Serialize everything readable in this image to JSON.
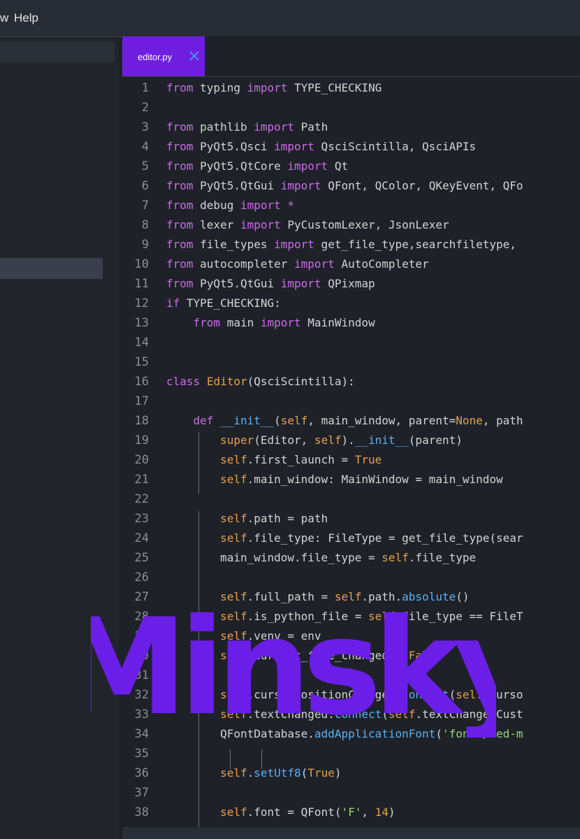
{
  "menubar": {
    "item_view_partial": "w",
    "item_help": "Help"
  },
  "tab": {
    "label": "editor.py",
    "close_icon": "close-icon"
  },
  "watermark": {
    "text": "Minsky"
  },
  "lines": [
    {
      "n": "1",
      "segs": [
        [
          "kw",
          "from"
        ],
        [
          "",
          " typing "
        ],
        [
          "kw",
          "import"
        ],
        [
          "",
          " TYPE_CHECKING"
        ]
      ]
    },
    {
      "n": "2",
      "segs": []
    },
    {
      "n": "3",
      "segs": [
        [
          "kw",
          "from"
        ],
        [
          "",
          " pathlib "
        ],
        [
          "kw",
          "import"
        ],
        [
          "",
          " Path"
        ]
      ]
    },
    {
      "n": "4",
      "segs": [
        [
          "kw",
          "from"
        ],
        [
          "",
          " PyQt5.Qsci "
        ],
        [
          "kw",
          "import"
        ],
        [
          "",
          " QsciScintilla, QsciAPIs"
        ]
      ]
    },
    {
      "n": "5",
      "segs": [
        [
          "kw",
          "from"
        ],
        [
          "",
          " PyQt5.QtCore "
        ],
        [
          "kw",
          "import"
        ],
        [
          "",
          " Qt"
        ]
      ]
    },
    {
      "n": "6",
      "segs": [
        [
          "kw",
          "from"
        ],
        [
          "",
          " PyQt5.QtGui "
        ],
        [
          "kw",
          "import"
        ],
        [
          "",
          " QFont, QColor, QKeyEvent, QFo"
        ]
      ]
    },
    {
      "n": "7",
      "segs": [
        [
          "kw",
          "from"
        ],
        [
          "",
          " debug "
        ],
        [
          "kw",
          "import"
        ],
        [
          "",
          " "
        ],
        [
          "op",
          "*"
        ]
      ]
    },
    {
      "n": "8",
      "segs": [
        [
          "kw",
          "from"
        ],
        [
          "",
          " lexer "
        ],
        [
          "kw",
          "import"
        ],
        [
          "",
          " PyCustomLexer, JsonLexer"
        ]
      ]
    },
    {
      "n": "9",
      "segs": [
        [
          "kw",
          "from"
        ],
        [
          "",
          " file_types "
        ],
        [
          "kw",
          "import"
        ],
        [
          "",
          " get_file_type,searchfiletype,"
        ]
      ]
    },
    {
      "n": "10",
      "segs": [
        [
          "kw",
          "from"
        ],
        [
          "",
          " autocompleter "
        ],
        [
          "kw",
          "import"
        ],
        [
          "",
          " AutoCompleter"
        ]
      ]
    },
    {
      "n": "11",
      "segs": [
        [
          "kw",
          "from"
        ],
        [
          "",
          " PyQt5.QtGui "
        ],
        [
          "kw",
          "import"
        ],
        [
          "",
          " QPixmap"
        ]
      ]
    },
    {
      "n": "12",
      "segs": [
        [
          "kw",
          "if"
        ],
        [
          "",
          " TYPE_CHECKING:"
        ]
      ]
    },
    {
      "n": "13",
      "segs": [
        [
          "",
          "    "
        ],
        [
          "kw",
          "from"
        ],
        [
          "",
          " main "
        ],
        [
          "kw",
          "import"
        ],
        [
          "",
          " MainWindow"
        ]
      ]
    },
    {
      "n": "14",
      "segs": []
    },
    {
      "n": "15",
      "segs": []
    },
    {
      "n": "16",
      "segs": [
        [
          "kw",
          "class"
        ],
        [
          "",
          " "
        ],
        [
          "cls",
          "Editor"
        ],
        [
          "",
          "(QsciScintilla):"
        ]
      ]
    },
    {
      "n": "17",
      "segs": []
    },
    {
      "n": "18",
      "segs": [
        [
          "",
          "    "
        ],
        [
          "kw",
          "def"
        ],
        [
          "",
          " "
        ],
        [
          "fn",
          "__init__"
        ],
        [
          "",
          "("
        ],
        [
          "self",
          "self"
        ],
        [
          "",
          ", main_window, parent="
        ],
        [
          "const",
          "None"
        ],
        [
          "",
          ", path"
        ]
      ]
    },
    {
      "n": "19",
      "segs": [
        [
          "",
          "        "
        ],
        [
          "self",
          "super"
        ],
        [
          "",
          "(Editor, "
        ],
        [
          "self",
          "self"
        ],
        [
          "",
          ")."
        ],
        [
          "fn",
          "__init__"
        ],
        [
          "",
          "(parent)"
        ]
      ]
    },
    {
      "n": "20",
      "segs": [
        [
          "",
          "        "
        ],
        [
          "self",
          "self"
        ],
        [
          "",
          ".first_launch = "
        ],
        [
          "const",
          "True"
        ]
      ]
    },
    {
      "n": "21",
      "segs": [
        [
          "",
          "        "
        ],
        [
          "self",
          "self"
        ],
        [
          "",
          ".main_window: MainWindow = main_window"
        ]
      ]
    },
    {
      "n": "22",
      "segs": []
    },
    {
      "n": "23",
      "segs": [
        [
          "",
          "        "
        ],
        [
          "self",
          "self"
        ],
        [
          "",
          ".path = path"
        ]
      ]
    },
    {
      "n": "24",
      "segs": [
        [
          "",
          "        "
        ],
        [
          "self",
          "self"
        ],
        [
          "",
          ".file_type: FileType = get_file_type(sear"
        ]
      ]
    },
    {
      "n": "25",
      "segs": [
        [
          "",
          "        main_window.file_type = "
        ],
        [
          "self",
          "self"
        ],
        [
          "",
          ".file_type"
        ]
      ]
    },
    {
      "n": "26",
      "segs": []
    },
    {
      "n": "27",
      "segs": [
        [
          "",
          "        "
        ],
        [
          "self",
          "self"
        ],
        [
          "",
          ".full_path = "
        ],
        [
          "self",
          "self"
        ],
        [
          "",
          ".path."
        ],
        [
          "fn",
          "absolute"
        ],
        [
          "",
          "()"
        ]
      ]
    },
    {
      "n": "28",
      "segs": [
        [
          "",
          "        "
        ],
        [
          "self",
          "self"
        ],
        [
          "",
          ".is_python_file = "
        ],
        [
          "self",
          "self"
        ],
        [
          "",
          ".file_type == FileT"
        ]
      ]
    },
    {
      "n": "29",
      "segs": [
        [
          "",
          "        "
        ],
        [
          "self",
          "self"
        ],
        [
          "",
          ".venv = env"
        ]
      ]
    },
    {
      "n": "30",
      "segs": [
        [
          "",
          "        "
        ],
        [
          "self",
          "self"
        ],
        [
          "",
          ".current_file_changed = "
        ],
        [
          "const",
          "False"
        ]
      ]
    },
    {
      "n": "31",
      "segs": []
    },
    {
      "n": "32",
      "segs": [
        [
          "",
          "        "
        ],
        [
          "self",
          "self"
        ],
        [
          "",
          ".cursorPositionChanged."
        ],
        [
          "fn",
          "connect"
        ],
        [
          "",
          "("
        ],
        [
          "self",
          "self"
        ],
        [
          "",
          ".curso"
        ]
      ]
    },
    {
      "n": "33",
      "segs": [
        [
          "",
          "        "
        ],
        [
          "self",
          "self"
        ],
        [
          "",
          ".textChanged."
        ],
        [
          "fn",
          "connect"
        ],
        [
          "",
          "("
        ],
        [
          "self",
          "self"
        ],
        [
          "",
          ".textChangedCust"
        ]
      ]
    },
    {
      "n": "34",
      "segs": [
        [
          "",
          "        QFontDatabase."
        ],
        [
          "fn",
          "addApplicationFont"
        ],
        [
          "",
          "("
        ],
        [
          "str",
          "'fonts/zed-m"
        ]
      ]
    },
    {
      "n": "35",
      "segs": []
    },
    {
      "n": "36",
      "segs": [
        [
          "",
          "        "
        ],
        [
          "self",
          "self"
        ],
        [
          "",
          "."
        ],
        [
          "fn",
          "setUtf8"
        ],
        [
          "",
          "("
        ],
        [
          "const",
          "True"
        ],
        [
          "",
          ")"
        ]
      ]
    },
    {
      "n": "37",
      "segs": []
    },
    {
      "n": "38",
      "segs": [
        [
          "",
          "        "
        ],
        [
          "self",
          "self"
        ],
        [
          "",
          ".font = QFont("
        ],
        [
          "str",
          "'F'"
        ],
        [
          "",
          ", "
        ],
        [
          "num",
          "14"
        ],
        [
          "",
          ")"
        ]
      ]
    }
  ]
}
